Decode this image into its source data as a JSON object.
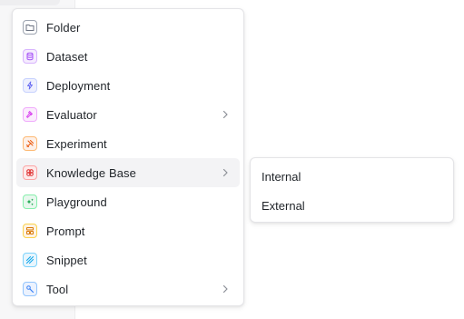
{
  "menu": {
    "items": [
      {
        "label": "Folder",
        "icon": "folder-icon",
        "color": "#6b7280",
        "bg": "#ffffff",
        "has_submenu": false
      },
      {
        "label": "Dataset",
        "icon": "database-icon",
        "color": "#a855f7",
        "bg": "#f5ecfe",
        "has_submenu": false
      },
      {
        "label": "Deployment",
        "icon": "lightning-icon",
        "color": "#6366f1",
        "bg": "#eef0fe",
        "has_submenu": false
      },
      {
        "label": "Evaluator",
        "icon": "gavel-icon",
        "color": "#d946ef",
        "bg": "#fbecfd",
        "has_submenu": true
      },
      {
        "label": "Experiment",
        "icon": "experiment-icon",
        "color": "#ea580c",
        "bg": "#fdf0e8",
        "has_submenu": false
      },
      {
        "label": "Knowledge Base",
        "icon": "brain-icon",
        "color": "#dc2626",
        "bg": "#fdeaea",
        "has_submenu": true
      },
      {
        "label": "Playground",
        "icon": "sparkle-icon",
        "color": "#16a34a",
        "bg": "#e8f7ee",
        "has_submenu": false
      },
      {
        "label": "Prompt",
        "icon": "prompt-icon",
        "color": "#d97706",
        "bg": "#fdf3e3",
        "has_submenu": false
      },
      {
        "label": "Snippet",
        "icon": "snippet-icon",
        "color": "#0ea5e9",
        "bg": "#e7f5fd",
        "has_submenu": false
      },
      {
        "label": "Tool",
        "icon": "wrench-icon",
        "color": "#3b82f6",
        "bg": "#ebf2fe",
        "has_submenu": true
      }
    ],
    "active_item": "Knowledge Base"
  },
  "submenu": {
    "items": [
      {
        "label": "Internal"
      },
      {
        "label": "External"
      }
    ]
  }
}
